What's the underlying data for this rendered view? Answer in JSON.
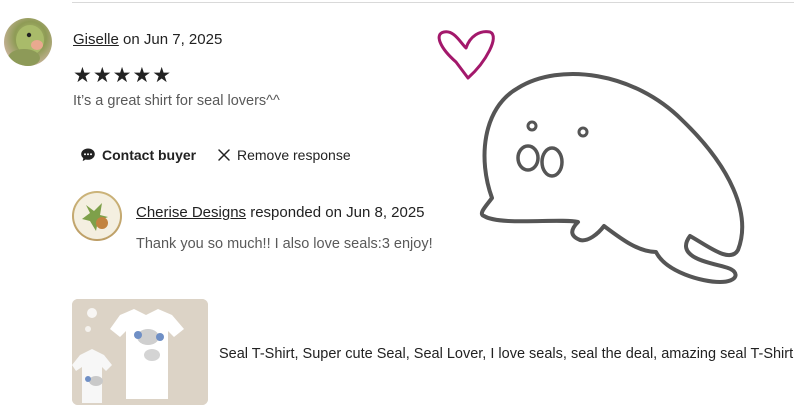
{
  "review": {
    "reviewer_name": "Giselle",
    "date_text": "on Jun 7, 2025",
    "rating": 5,
    "stars": "★★★★★",
    "text": "It’s a great shirt for seal lovers^^"
  },
  "actions": {
    "contact_label": "Contact buyer",
    "remove_label": "Remove response"
  },
  "response": {
    "shop_name": "Cherise Designs",
    "date_text": "responded on Jun 8, 2025",
    "text": "Thank you so much!! I also love seals:3 enjoy!"
  },
  "product": {
    "title": "Seal T-Shirt, Super cute Seal, Seal Lover, I love seals, seal the deal, amazing seal T-Shirt"
  },
  "colors": {
    "heart": "#a3186b",
    "seal_outline": "#555555"
  },
  "icons": {
    "contact": "chat-bubble-icon",
    "remove": "close-icon"
  }
}
